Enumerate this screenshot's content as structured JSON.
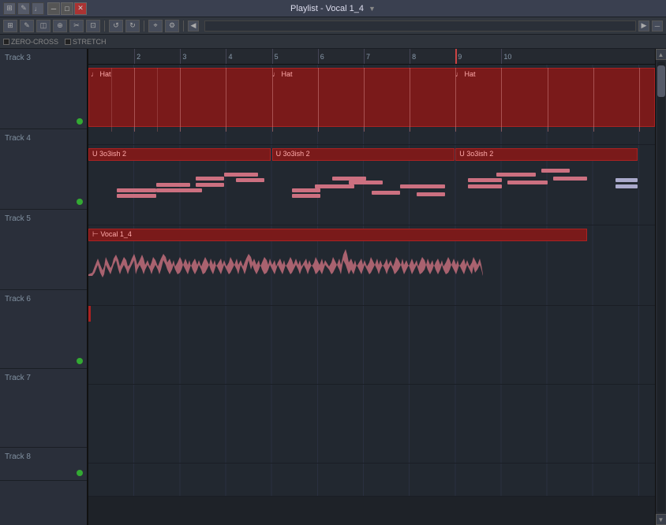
{
  "titleBar": {
    "title": "Playlist - Vocal 1_4",
    "dropdownArrow": "▼",
    "minBtn": "─",
    "maxBtn": "□",
    "closeBtn": "✕"
  },
  "toolbar": {
    "tools": [
      "⊞",
      "✎",
      "◫",
      "⌖",
      "✂",
      "◻",
      "↺",
      "↻"
    ],
    "navLeft": "◀",
    "navRight": "▶",
    "scrollMinus": "─"
  },
  "optionsBar": {
    "zeroCross": "ZERO-CROSS",
    "stretch": "STRETCH"
  },
  "timeline": {
    "markers": [
      {
        "label": "2",
        "left": "8.1%"
      },
      {
        "label": "3",
        "left": "16.2%"
      },
      {
        "label": "4",
        "left": "24.3%"
      },
      {
        "label": "5",
        "left": "32.4%"
      },
      {
        "label": "6",
        "left": "40.5%"
      },
      {
        "label": "7",
        "left": "48.6%"
      },
      {
        "label": "8",
        "left": "56.7%"
      },
      {
        "label": "9",
        "left": "64.8%"
      },
      {
        "label": "10",
        "left": "72.9%"
      }
    ]
  },
  "tracks": [
    {
      "id": "t3",
      "name": "Track 3",
      "hasGreenDot": true,
      "clips": [
        {
          "type": "hat",
          "label": "♩ Hat",
          "left": "0%",
          "width": "100%"
        }
      ],
      "hatRepeats": [
        {
          "left": "0%",
          "label": "♩ Hat"
        },
        {
          "left": "32.4%",
          "label": "♩ Hat"
        },
        {
          "left": "64.8%",
          "label": "♩ Hat"
        }
      ]
    },
    {
      "id": "t4",
      "name": "Track 4",
      "hasGreenDot": true,
      "clips": [],
      "label3o3": [
        {
          "left": "0%",
          "label": "U 3o3ish 2"
        },
        {
          "left": "32.4%",
          "label": "U 3o3ish 2"
        },
        {
          "left": "64.8%",
          "label": "U 3o3ish 2"
        }
      ]
    },
    {
      "id": "t5",
      "name": "Track 5",
      "hasGreenDot": false,
      "vocalLabel": "⊢ Vocal 1_4"
    },
    {
      "id": "t6",
      "name": "Track 6",
      "hasGreenDot": true,
      "clips": []
    },
    {
      "id": "t7",
      "name": "Track 7",
      "hasGreenDot": false,
      "clips": []
    },
    {
      "id": "t8",
      "name": "Track 8",
      "hasGreenDot": true,
      "clips": []
    }
  ],
  "colors": {
    "accent": "#c06070",
    "darkRed": "#7a1a1a",
    "background": "#2a2f38",
    "trackBg": "#222830"
  }
}
